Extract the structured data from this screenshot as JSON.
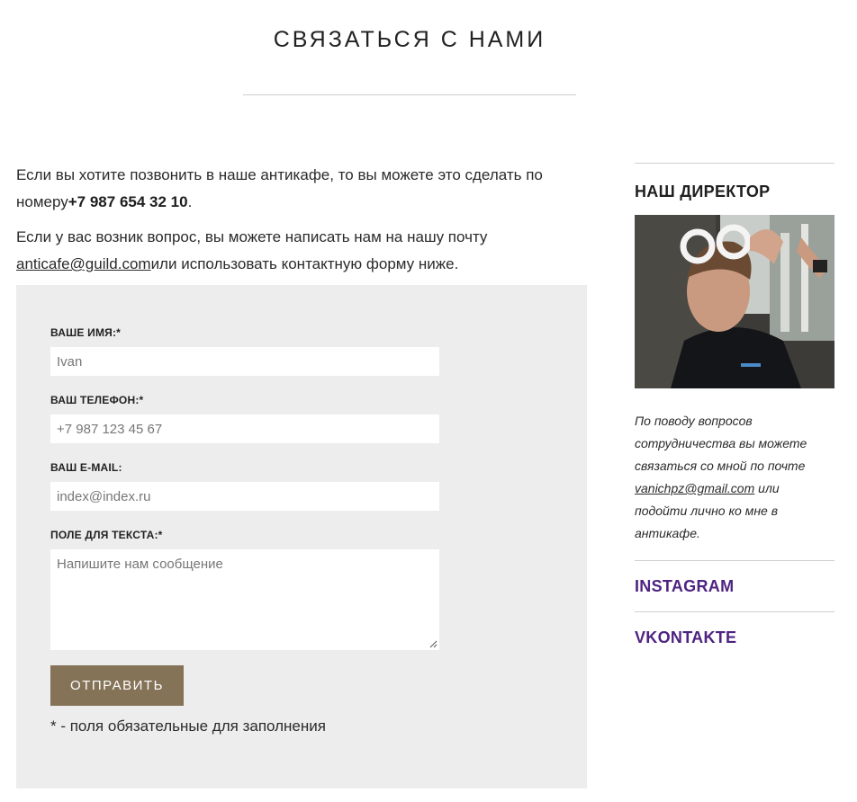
{
  "header": {
    "title": "СВЯЗАТЬСЯ С НАМИ"
  },
  "intro": {
    "phone_text": "Если вы хотите позвонить в наше антикафе, то вы можете это сделать по номеру",
    "phone_number": "+7 987 654 32 10",
    "phone_end": ".",
    "email_text": "Если у вас возник вопрос, вы можете написать нам на нашу почту",
    "email": "anticafe@guild.com",
    "email_after": "или использовать контактную форму ниже."
  },
  "form": {
    "name_label": "ВАШЕ ИМЯ:*",
    "name_placeholder": "Ivan",
    "phone_label": "ВАШ ТЕЛЕФОН:*",
    "phone_placeholder": "+7 987 123 45 67",
    "email_label": "ВАШ E-MAIL:",
    "email_placeholder": "index@index.ru",
    "message_label": "ПОЛЕ ДЛЯ ТЕКСТА:*",
    "message_placeholder": "Напишите нам сообщение",
    "submit_label": "ОТПРАВИТЬ",
    "required_note": "* - поля обязательные для заполнения"
  },
  "sidebar": {
    "director_heading": "НАШ ДИРЕКТОР",
    "director_text_before": "По поводу вопросов сотрудничества вы можете связаться со мной по почте",
    "director_email": "vanichpz@gmail.com",
    "director_text_after": "или подойти лично ко мне в антикафе.",
    "links": [
      {
        "label": "INSTAGRAM"
      },
      {
        "label": "VKONTAKTE"
      }
    ],
    "link_color": "#4e2381"
  },
  "colors": {
    "button": "#857358",
    "panel": "#ededed"
  }
}
